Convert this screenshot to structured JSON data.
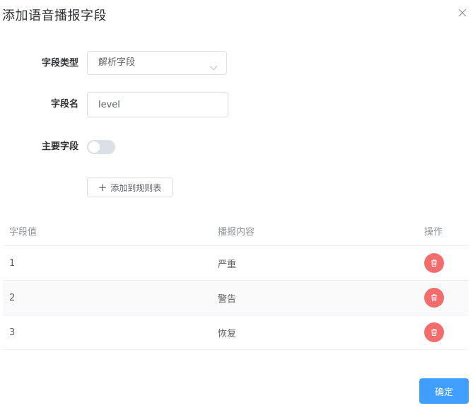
{
  "dialog": {
    "title": "添加语音播报字段",
    "close_icon": "close-icon"
  },
  "form": {
    "field_type": {
      "label": "字段类型",
      "value": "解析字段",
      "icon": "chevron-down-icon"
    },
    "field_name": {
      "label": "字段名",
      "value": "level"
    },
    "primary_field": {
      "label": "主要字段",
      "checked": false
    },
    "add_button": {
      "icon": "plus-icon",
      "label": "添加到规则表"
    }
  },
  "table": {
    "headers": [
      "字段值",
      "播报内容",
      "操作"
    ],
    "rows": [
      {
        "value": "1",
        "content": "严重",
        "action_icon": "trash-icon"
      },
      {
        "value": "2",
        "content": "警告",
        "action_icon": "trash-icon"
      },
      {
        "value": "3",
        "content": "恢复",
        "action_icon": "trash-icon"
      }
    ]
  },
  "footer": {
    "confirm_label": "确定"
  },
  "colors": {
    "primary": "#409eff",
    "danger": "#f56c6c",
    "border": "#dcdfe6"
  }
}
